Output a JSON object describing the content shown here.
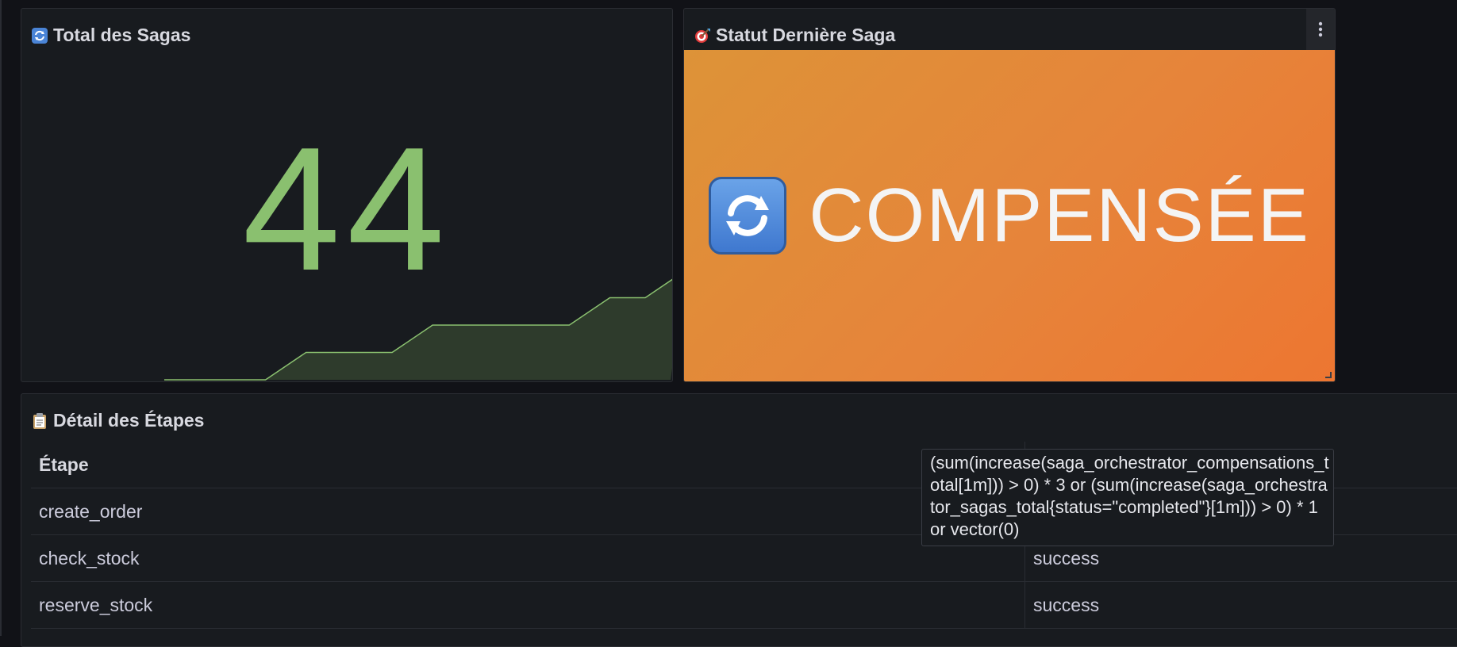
{
  "panels": {
    "total": {
      "title": "Total des Sagas",
      "icon": "counterclockwise-arrows-icon",
      "value": "44",
      "value_color": "#8ac06f",
      "sparkline_values": [
        0,
        0,
        0,
        0,
        0,
        1,
        1,
        1,
        1,
        1,
        2,
        2,
        2,
        2,
        2,
        2,
        2,
        3,
        3,
        3,
        4
      ]
    },
    "status": {
      "title": "Statut Dernière Saga",
      "icon": "direct-hit-icon",
      "value_icon": "counterclockwise-arrows-icon",
      "value": "COMPENSÉE",
      "background": "#e6843a"
    },
    "steps": {
      "title": "Détail des Étapes",
      "icon": "clipboard-icon",
      "columns": [
        "Étape",
        ""
      ],
      "rows": [
        {
          "step": "create_order",
          "status": ""
        },
        {
          "step": "check_stock",
          "status": "success"
        },
        {
          "step": "reserve_stock",
          "status": "success"
        }
      ]
    }
  },
  "tooltip": {
    "text": "(sum(increase(saga_orchestrator_compensations_total[1m])) > 0) * 3 or (sum(increase(saga_orchestrator_sagas_total{status=\"completed\"}[1m])) > 0) * 1 or vector(0)"
  }
}
